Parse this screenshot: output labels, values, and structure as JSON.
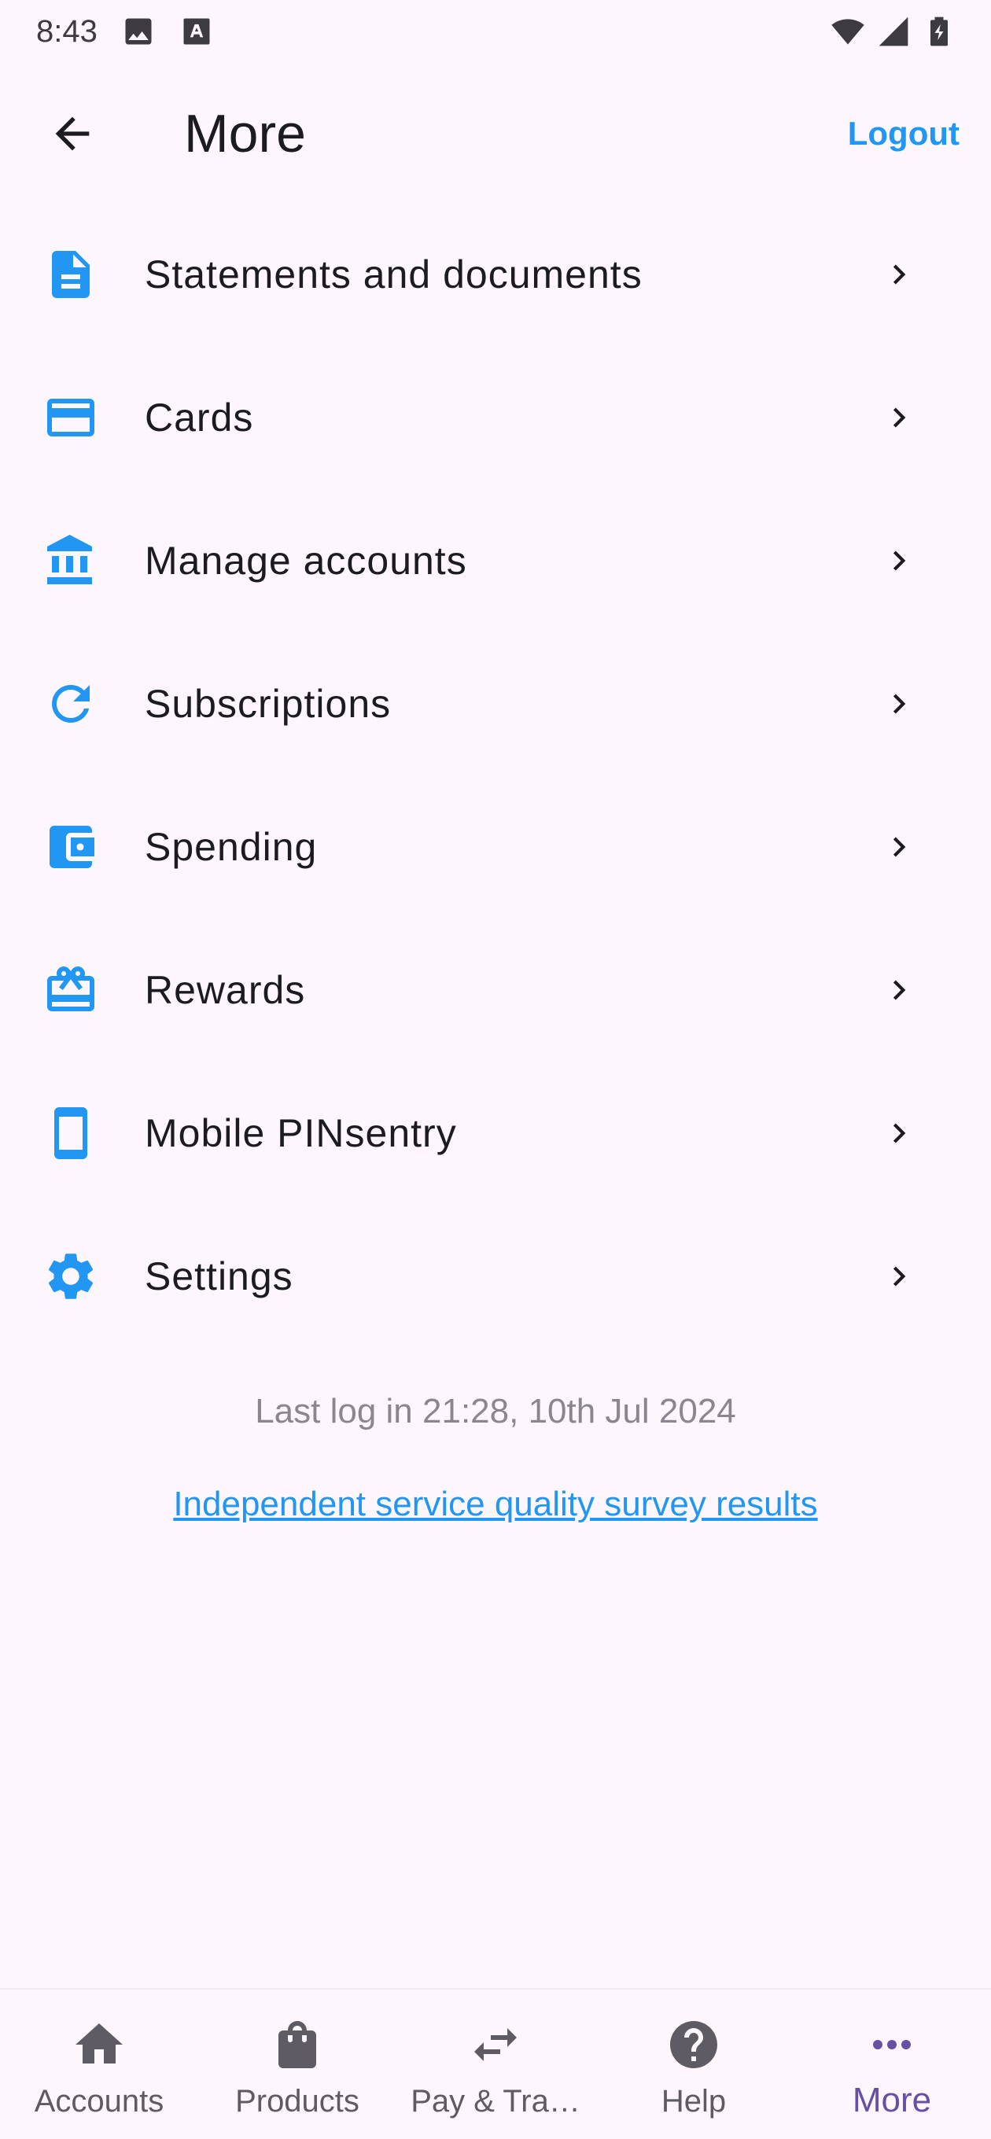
{
  "status_bar": {
    "time": "8:43"
  },
  "app_bar": {
    "title": "More",
    "logout_label": "Logout"
  },
  "colors": {
    "accent": "#2196F3",
    "active_nav": "#6750A4",
    "background": "#FDF7FD"
  },
  "menu": {
    "items": [
      {
        "label": "Statements and documents",
        "icon": "document-icon"
      },
      {
        "label": "Cards",
        "icon": "credit-card-icon"
      },
      {
        "label": "Manage accounts",
        "icon": "bank-icon"
      },
      {
        "label": "Subscriptions",
        "icon": "refresh-icon"
      },
      {
        "label": "Spending",
        "icon": "wallet-icon"
      },
      {
        "label": "Rewards",
        "icon": "gift-card-icon"
      },
      {
        "label": "Mobile PINsentry",
        "icon": "phone-icon"
      },
      {
        "label": "Settings",
        "icon": "gear-icon"
      }
    ]
  },
  "footer": {
    "last_login": "Last log in 21:28, 10th Jul 2024",
    "survey_link": "Independent service quality survey results"
  },
  "bottom_nav": {
    "items": [
      {
        "label": "Accounts",
        "icon": "home-icon",
        "active": false
      },
      {
        "label": "Products",
        "icon": "shopping-bag-icon",
        "active": false
      },
      {
        "label": "Pay & Tra…",
        "icon": "transfer-icon",
        "active": false
      },
      {
        "label": "Help",
        "icon": "help-icon",
        "active": false
      },
      {
        "label": "More",
        "icon": "more-dots-icon",
        "active": true
      }
    ]
  }
}
